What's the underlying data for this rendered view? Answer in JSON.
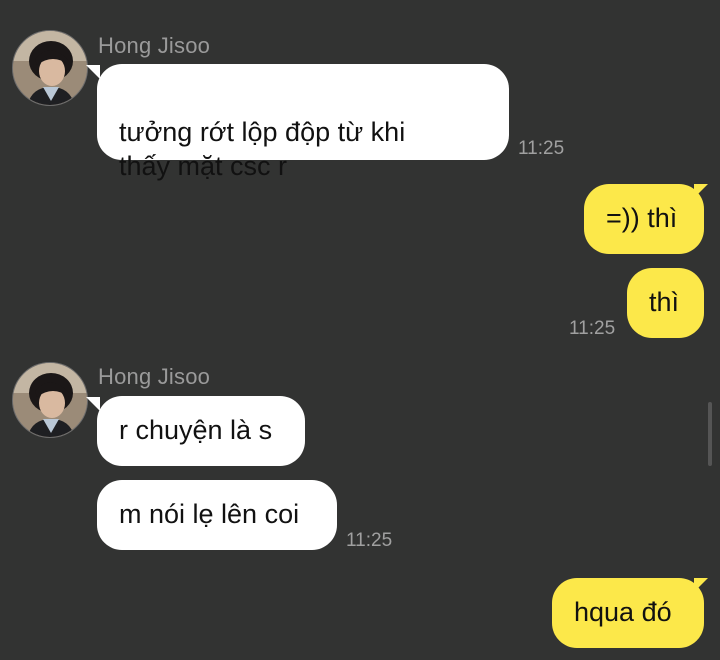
{
  "messages": [
    {
      "sender": "Hong Jisoo",
      "text": "tưởng rớt lộp độp từ khi\nthấy mặt csc r",
      "time": "11:25"
    },
    {
      "text": "=)) thì"
    },
    {
      "text": "thì",
      "time": "11:25"
    },
    {
      "sender": "Hong Jisoo",
      "text": "r chuyện là s"
    },
    {
      "text": "m nói lẹ lên coi",
      "time": "11:25"
    },
    {
      "text": "hqua đó"
    }
  ],
  "colors": {
    "background": "#323332",
    "incoming_bubble": "#ffffff",
    "outgoing_bubble": "#fce84a",
    "sender_name": "#9a9a9a",
    "timestamp": "#a0a0a0"
  }
}
